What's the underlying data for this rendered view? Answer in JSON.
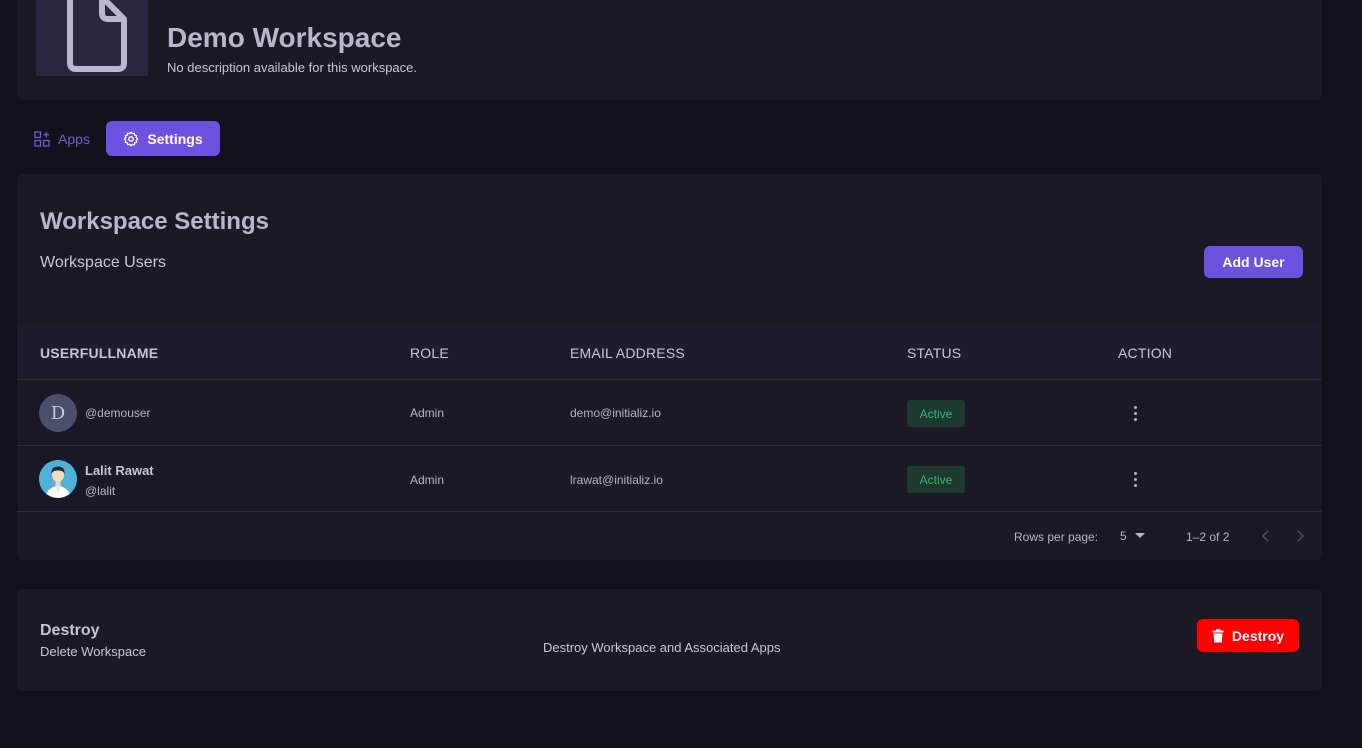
{
  "header": {
    "title": "Demo Workspace",
    "description": "No description available for this workspace.",
    "thumbnail_icon": "document-icon"
  },
  "tabs": [
    {
      "label": "Apps",
      "icon": "apps-grid-icon",
      "active": false
    },
    {
      "label": "Settings",
      "icon": "gear-icon",
      "active": true
    }
  ],
  "settings": {
    "title": "Workspace Settings",
    "subtitle": "Workspace Users",
    "add_user_label": "Add User",
    "columns": [
      "USERFULLNAME",
      "ROLE",
      "EMAIL ADDRESS",
      "STATUS",
      "ACTION"
    ],
    "users": [
      {
        "avatar_letter": "D",
        "fullname": "",
        "username": "@demouser",
        "role": "Admin",
        "email": "demo@initializ.io",
        "status": "Active"
      },
      {
        "avatar_letter": "",
        "fullname": "Lalit Rawat",
        "username": "@lalit",
        "role": "Admin",
        "email": "lrawat@initializ.io",
        "status": "Active"
      }
    ],
    "pagination": {
      "rows_per_page_label": "Rows per page:",
      "rows_per_page": "5",
      "range": "1–2 of 2"
    }
  },
  "destroy": {
    "title": "Destroy",
    "subtitle": "Delete Workspace",
    "description": "Destroy Workspace and Associated Apps",
    "button_label": "Destroy"
  },
  "colors": {
    "accent": "#6d52e0",
    "danger": "#ff0000",
    "status_active": "#2dbb6e"
  }
}
